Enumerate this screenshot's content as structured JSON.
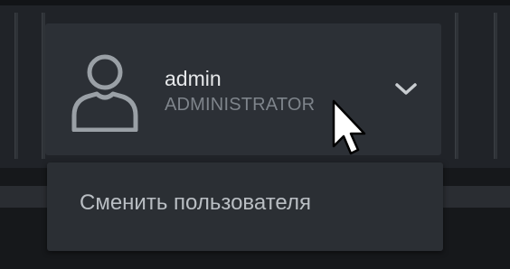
{
  "user": {
    "name": "admin",
    "role": "ADMINISTRATOR",
    "avatar_icon": "user-avatar-icon",
    "toggle_icon": "chevron-down-icon"
  },
  "menu": {
    "items": [
      {
        "label": "Сменить пользователя"
      }
    ]
  },
  "colors": {
    "background": "#1d2024",
    "panel": "#2c3036",
    "name_text": "#e6e8ea",
    "role_text": "#7e848b",
    "menu_text": "#b9bec3"
  }
}
